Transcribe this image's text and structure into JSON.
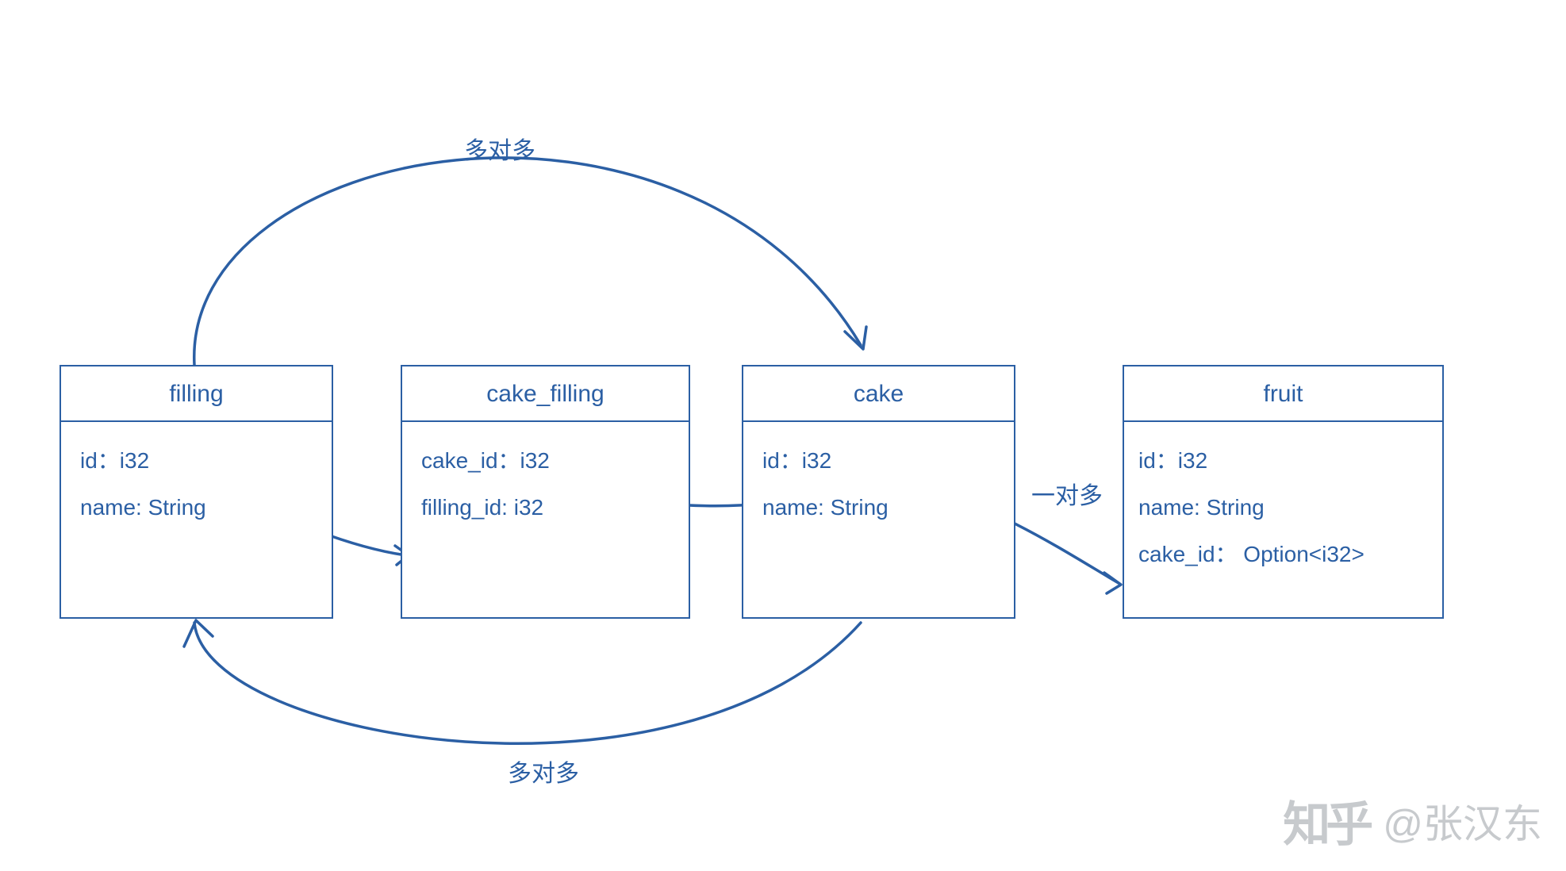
{
  "entities": {
    "filling": {
      "name": "filling",
      "fields": [
        "id：i32",
        "name: String"
      ]
    },
    "cake_filling": {
      "name": "cake_filling",
      "fields": [
        "cake_id：i32",
        "filling_id: i32"
      ]
    },
    "cake": {
      "name": "cake",
      "fields": [
        "id：i32",
        "name: String"
      ]
    },
    "fruit": {
      "name": "fruit",
      "fields": [
        "id：i32",
        "name: String",
        "cake_id： Option<i32>"
      ]
    }
  },
  "relationships": {
    "top": "多对多",
    "bottom": "多对多",
    "right": "一对多"
  },
  "watermark": {
    "site": "知乎",
    "author": "@张汉东"
  }
}
